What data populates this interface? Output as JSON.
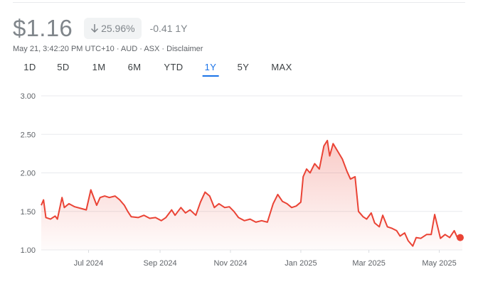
{
  "header": {
    "price": "$1.16",
    "change_pct": "25.96%",
    "change_abs": "-0.41 1Y",
    "timestamp": "May 21, 3:42:20 PM UTC+10 · AUD · ASX · ",
    "disclaimer": "Disclaimer"
  },
  "ranges": {
    "items": [
      "1D",
      "5D",
      "1M",
      "6M",
      "YTD",
      "1Y",
      "5Y",
      "MAX"
    ],
    "active": "1Y"
  },
  "colors": {
    "line": "#ea4335",
    "down": "#80868b",
    "accent": "#1a73e8",
    "grid": "#e8eaed"
  },
  "chart_data": {
    "type": "area",
    "x_start": "2024-05-21",
    "x_end": "2025-05-21",
    "ylim": [
      1.0,
      3.0
    ],
    "y_ticks": [
      "3.00",
      "2.50",
      "2.00",
      "1.50",
      "1.00"
    ],
    "x_ticks": [
      "Jul 2024",
      "Sep 2024",
      "Nov 2024",
      "Jan 2025",
      "Mar 2025",
      "May 2025"
    ],
    "grid": true,
    "points": [
      [
        "2024-05-21",
        1.58
      ],
      [
        "2024-05-23",
        1.65
      ],
      [
        "2024-05-25",
        1.42
      ],
      [
        "2024-05-29",
        1.4
      ],
      [
        "2024-06-02",
        1.44
      ],
      [
        "2024-06-04",
        1.4
      ],
      [
        "2024-06-08",
        1.68
      ],
      [
        "2024-06-10",
        1.55
      ],
      [
        "2024-06-14",
        1.6
      ],
      [
        "2024-06-19",
        1.56
      ],
      [
        "2024-06-24",
        1.54
      ],
      [
        "2024-06-29",
        1.52
      ],
      [
        "2024-07-03",
        1.78
      ],
      [
        "2024-07-05",
        1.7
      ],
      [
        "2024-07-08",
        1.58
      ],
      [
        "2024-07-11",
        1.68
      ],
      [
        "2024-07-15",
        1.7
      ],
      [
        "2024-07-19",
        1.68
      ],
      [
        "2024-07-24",
        1.7
      ],
      [
        "2024-07-28",
        1.65
      ],
      [
        "2024-08-01",
        1.58
      ],
      [
        "2024-08-04",
        1.5
      ],
      [
        "2024-08-07",
        1.43
      ],
      [
        "2024-08-13",
        1.42
      ],
      [
        "2024-08-18",
        1.45
      ],
      [
        "2024-08-23",
        1.41
      ],
      [
        "2024-08-28",
        1.42
      ],
      [
        "2024-09-02",
        1.38
      ],
      [
        "2024-09-06",
        1.42
      ],
      [
        "2024-09-11",
        1.52
      ],
      [
        "2024-09-14",
        1.45
      ],
      [
        "2024-09-19",
        1.55
      ],
      [
        "2024-09-23",
        1.48
      ],
      [
        "2024-09-27",
        1.52
      ],
      [
        "2024-10-02",
        1.45
      ],
      [
        "2024-10-06",
        1.62
      ],
      [
        "2024-10-10",
        1.75
      ],
      [
        "2024-10-14",
        1.7
      ],
      [
        "2024-10-18",
        1.55
      ],
      [
        "2024-10-22",
        1.6
      ],
      [
        "2024-10-27",
        1.55
      ],
      [
        "2024-10-31",
        1.56
      ],
      [
        "2024-11-04",
        1.5
      ],
      [
        "2024-11-08",
        1.42
      ],
      [
        "2024-11-13",
        1.38
      ],
      [
        "2024-11-18",
        1.4
      ],
      [
        "2024-11-23",
        1.36
      ],
      [
        "2024-11-28",
        1.38
      ],
      [
        "2024-12-03",
        1.36
      ],
      [
        "2024-12-08",
        1.6
      ],
      [
        "2024-12-12",
        1.72
      ],
      [
        "2024-12-16",
        1.63
      ],
      [
        "2024-12-20",
        1.6
      ],
      [
        "2024-12-24",
        1.55
      ],
      [
        "2024-12-28",
        1.57
      ],
      [
        "2025-01-01",
        1.62
      ],
      [
        "2025-01-03",
        1.95
      ],
      [
        "2025-01-06",
        2.05
      ],
      [
        "2025-01-09",
        2.0
      ],
      [
        "2025-01-13",
        2.12
      ],
      [
        "2025-01-17",
        2.05
      ],
      [
        "2025-01-21",
        2.35
      ],
      [
        "2025-01-24",
        2.42
      ],
      [
        "2025-01-26",
        2.22
      ],
      [
        "2025-01-29",
        2.38
      ],
      [
        "2025-02-02",
        2.28
      ],
      [
        "2025-02-06",
        2.18
      ],
      [
        "2025-02-10",
        2.02
      ],
      [
        "2025-02-13",
        1.92
      ],
      [
        "2025-02-17",
        1.95
      ],
      [
        "2025-02-20",
        1.5
      ],
      [
        "2025-02-24",
        1.43
      ],
      [
        "2025-02-27",
        1.4
      ],
      [
        "2025-03-03",
        1.48
      ],
      [
        "2025-03-06",
        1.35
      ],
      [
        "2025-03-10",
        1.3
      ],
      [
        "2025-03-13",
        1.45
      ],
      [
        "2025-03-17",
        1.3
      ],
      [
        "2025-03-21",
        1.28
      ],
      [
        "2025-03-25",
        1.25
      ],
      [
        "2025-03-28",
        1.18
      ],
      [
        "2025-04-01",
        1.22
      ],
      [
        "2025-04-04",
        1.12
      ],
      [
        "2025-04-08",
        1.05
      ],
      [
        "2025-04-11",
        1.16
      ],
      [
        "2025-04-15",
        1.15
      ],
      [
        "2025-04-20",
        1.2
      ],
      [
        "2025-04-24",
        1.2
      ],
      [
        "2025-04-27",
        1.46
      ],
      [
        "2025-05-02",
        1.15
      ],
      [
        "2025-05-06",
        1.2
      ],
      [
        "2025-05-10",
        1.16
      ],
      [
        "2025-05-14",
        1.25
      ],
      [
        "2025-05-17",
        1.15
      ],
      [
        "2025-05-21",
        1.16
      ]
    ]
  }
}
